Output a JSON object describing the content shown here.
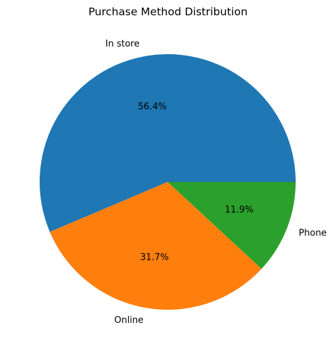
{
  "chart_data": {
    "type": "pie",
    "title": "Purchase Method Distribution",
    "categories": [
      "In store",
      "Online",
      "Phone"
    ],
    "values": [
      56.4,
      31.7,
      11.9
    ],
    "value_labels": [
      "56.4%",
      "31.7%",
      "11.9%"
    ],
    "colors": [
      "#1f77b4",
      "#ff7f0e",
      "#2ca02c"
    ],
    "start_angle_deg": 0,
    "direction": "counterclockwise",
    "legend": "none"
  }
}
